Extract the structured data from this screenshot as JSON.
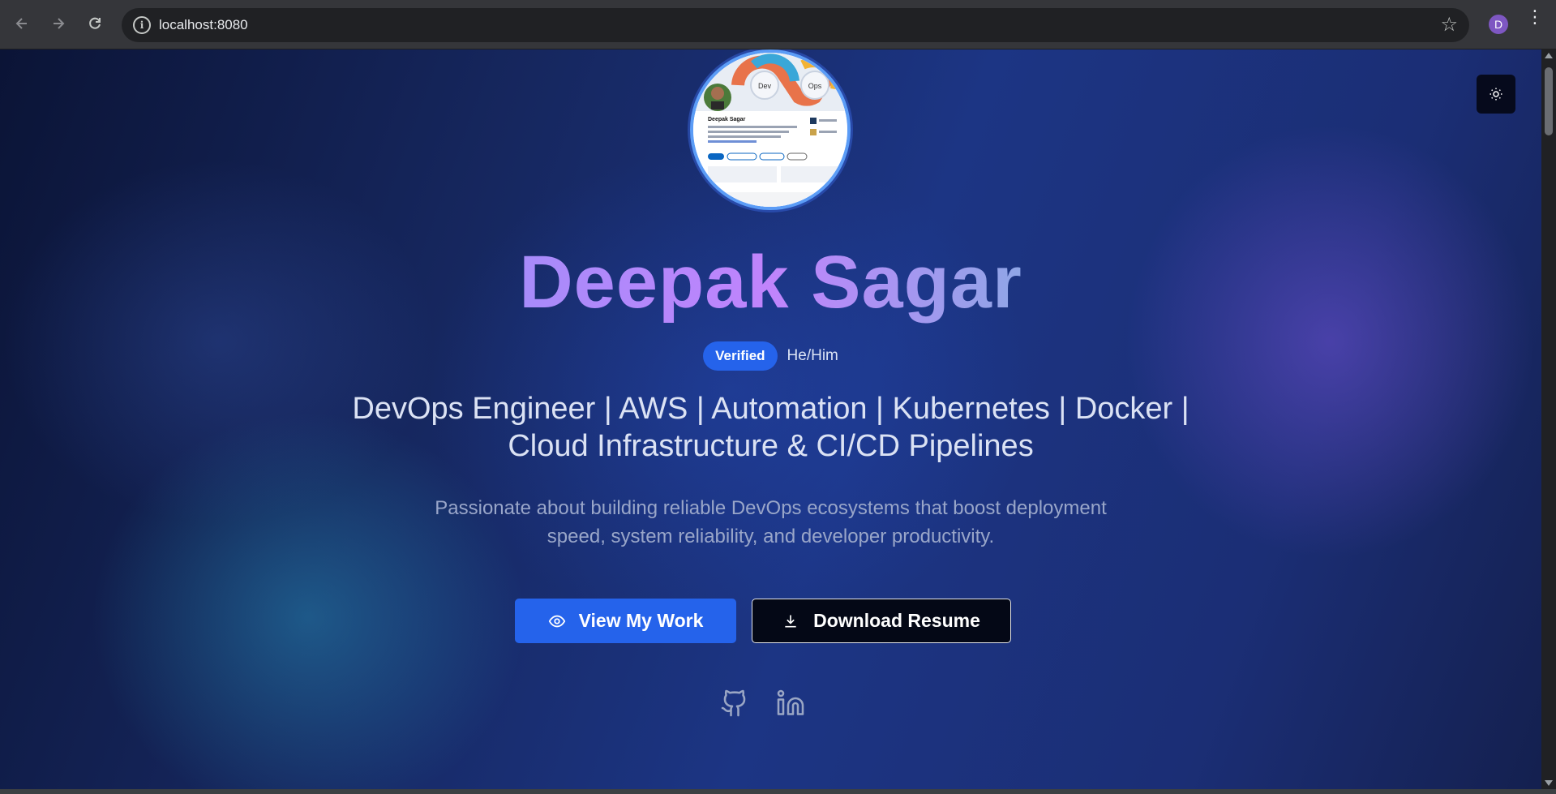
{
  "browser": {
    "url": "localhost:8080",
    "profile_initial": "D"
  },
  "hero": {
    "name": "Deepak Sagar",
    "badge": "Verified",
    "pronouns": "He/Him",
    "headline_line1": "DevOps Engineer | AWS | Automation | Kubernetes | Docker |",
    "headline_line2": "Cloud Infrastructure & CI/CD Pipelines",
    "tagline_line1": "Passionate about building reliable DevOps ecosystems that boost deployment",
    "tagline_line2": "speed, system reliability, and developer productivity.",
    "primary_button": "View My Work",
    "secondary_button": "Download Resume"
  },
  "avatar_text": {
    "dev": "Dev",
    "ops": "Ops",
    "profile_name": "Deepak Sagar"
  },
  "icons": {
    "theme_toggle": "sun-icon",
    "primary_button": "eye-icon",
    "secondary_button": "download-icon",
    "social": [
      "github-icon",
      "linkedin-icon"
    ]
  },
  "colors": {
    "accent": "#2563eb",
    "avatar_ring": "#5b9cf6",
    "title_gradient": [
      "#a78bfa",
      "#c084fc",
      "#8fa6e6"
    ]
  }
}
